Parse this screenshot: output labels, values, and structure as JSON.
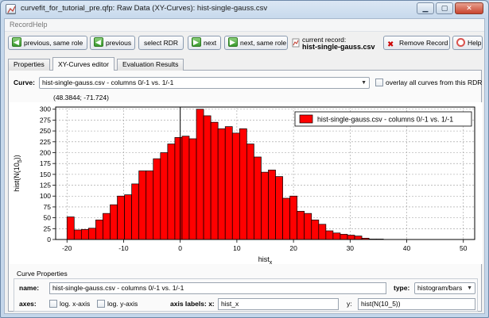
{
  "window": {
    "title": "curvefit_for_tutorial_pre.qfp: Raw Data (XY-Curves): hist-single-gauss.csv"
  },
  "menu": {
    "record": "Record",
    "help": "Help"
  },
  "toolbar": {
    "prev_same_role": "previous, same role",
    "previous": "previous",
    "select_rdr": "select RDR",
    "next": "next",
    "next_same_role": "next, same role",
    "current_record_label": "current record:",
    "current_record_value": "hist-single-gauss.csv",
    "remove_record": "Remove Record",
    "help": "Help"
  },
  "tabs": [
    {
      "label": "Properties"
    },
    {
      "label": "XY-Curves editor"
    },
    {
      "label": "Evaluation Results"
    }
  ],
  "editor": {
    "curve_label": "Curve:",
    "curve_value": "hist-single-gauss.csv - columns 0/-1 vs. 1/-1",
    "overlay_label": "overlay all curves from this RDR",
    "coords": "(48.3844; -71.724)"
  },
  "chart_data": {
    "type": "bar",
    "legend": "hist-single-gauss.csv - columns 0/-1 vs. 1/-1",
    "legend_position": "top-right",
    "xlabel": "hist",
    "xlabel_sub": "x",
    "ylabel": "hist(N(10",
    "ylabel_sub": "5",
    "ylabel_end": "))",
    "xlim": [
      -22,
      52
    ],
    "ylim": [
      0,
      305
    ],
    "xticks": [
      -20,
      -10,
      0,
      10,
      20,
      30,
      40,
      50
    ],
    "yticks": [
      0,
      25,
      50,
      75,
      100,
      125,
      150,
      175,
      200,
      225,
      250,
      275,
      300
    ],
    "grid": true,
    "bar_color": "#ff0000",
    "bin_width": 1.27,
    "x": [
      -20,
      -18.73,
      -17.46,
      -16.19,
      -14.92,
      -13.65,
      -12.38,
      -11.11,
      -9.84,
      -8.57,
      -7.3,
      -6.03,
      -4.76,
      -3.49,
      -2.22,
      -0.95,
      0.32,
      1.59,
      2.86,
      4.13,
      5.4,
      6.67,
      7.94,
      9.21,
      10.48,
      11.75,
      13.02,
      14.29,
      15.56,
      16.83,
      18.1,
      19.37,
      20.64,
      21.91,
      23.18,
      24.45,
      25.72,
      26.99,
      28.26,
      29.53,
      30.8,
      32.07,
      33.34,
      34.61
    ],
    "values": [
      52,
      22,
      23,
      26,
      45,
      60,
      80,
      100,
      103,
      128,
      158,
      158,
      186,
      200,
      220,
      235,
      238,
      232,
      300,
      285,
      270,
      255,
      260,
      245,
      255,
      220,
      190,
      155,
      160,
      145,
      95,
      100,
      65,
      60,
      45,
      35,
      20,
      15,
      12,
      10,
      8,
      3,
      1,
      1
    ]
  },
  "properties": {
    "section_title": "Curve Properties",
    "name_label": "name:",
    "name_value": "hist-single-gauss.csv - columns 0/-1 vs. 1/-1",
    "type_label": "type:",
    "type_value": "histogram/bars",
    "axes_label": "axes:",
    "log_x": "log. x-axis",
    "log_y": "log. y-axis",
    "axis_labels_x_label": "axis labels: x:",
    "x_value": "hist_x",
    "y_label": "y:",
    "y_value": "hist(N(10_5))"
  }
}
